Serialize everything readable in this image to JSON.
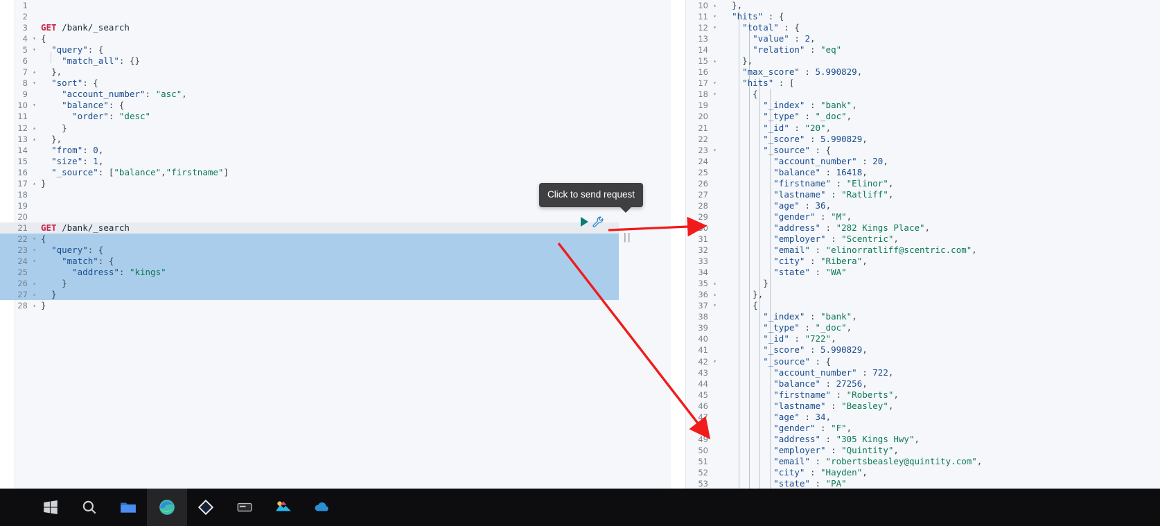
{
  "app": {
    "name": "kibana-dev-tools-console",
    "accent_teal": "#0b7a75",
    "highlight_blue": "#a9cdea",
    "tooltip_bg": "#3f3f42",
    "arrow_red": "#f01b1b"
  },
  "tooltip": {
    "text": "Click to send request"
  },
  "editor": {
    "icons": {
      "play": "play-icon",
      "wrench": "wrench-icon"
    },
    "lines": [
      {
        "n": "1",
        "fold": "",
        "text": ""
      },
      {
        "n": "2",
        "fold": "",
        "text": ""
      },
      {
        "n": "3",
        "fold": "",
        "text": "GET /bank/_search",
        "kind": "request"
      },
      {
        "n": "4",
        "fold": "▾",
        "text": "{"
      },
      {
        "n": "5",
        "fold": "▾",
        "text": "  \"query\": {"
      },
      {
        "n": "6",
        "fold": "",
        "text": "    \"match_all\": {}"
      },
      {
        "n": "7",
        "fold": "▴",
        "text": "  },"
      },
      {
        "n": "8",
        "fold": "▾",
        "text": "  \"sort\": {"
      },
      {
        "n": "9",
        "fold": "",
        "text": "    \"account_number\": \"asc\","
      },
      {
        "n": "10",
        "fold": "▾",
        "text": "    \"balance\": {"
      },
      {
        "n": "11",
        "fold": "",
        "text": "      \"order\": \"desc\""
      },
      {
        "n": "12",
        "fold": "▴",
        "text": "    }"
      },
      {
        "n": "13",
        "fold": "▴",
        "text": "  },"
      },
      {
        "n": "14",
        "fold": "",
        "text": "  \"from\": 0,"
      },
      {
        "n": "15",
        "fold": "",
        "text": "  \"size\": 1,"
      },
      {
        "n": "16",
        "fold": "",
        "text": "  \"_source\": [\"balance\",\"firstname\"]"
      },
      {
        "n": "17",
        "fold": "▴",
        "text": "}"
      },
      {
        "n": "18",
        "fold": "",
        "text": ""
      },
      {
        "n": "19",
        "fold": "",
        "text": ""
      },
      {
        "n": "20",
        "fold": "",
        "text": ""
      },
      {
        "n": "21",
        "fold": "",
        "text": "GET /bank/_search",
        "kind": "request",
        "selected": true,
        "current": true
      },
      {
        "n": "22",
        "fold": "▾",
        "text": "{",
        "selected": true
      },
      {
        "n": "23",
        "fold": "▾",
        "text": "  \"query\": {",
        "selected": true
      },
      {
        "n": "24",
        "fold": "▾",
        "text": "    \"match\": {",
        "selected": true
      },
      {
        "n": "25",
        "fold": "",
        "text": "      \"address\": \"kings\"",
        "selected": true
      },
      {
        "n": "26",
        "fold": "▴",
        "text": "    }",
        "selected": true
      },
      {
        "n": "27",
        "fold": "▴",
        "text": "  }",
        "selected": true
      },
      {
        "n": "28",
        "fold": "▴",
        "text": "}"
      }
    ]
  },
  "output": {
    "lines": [
      {
        "n": "10",
        "fold": "▴",
        "text": "  },"
      },
      {
        "n": "11",
        "fold": "▾",
        "text": "  \"hits\" : {"
      },
      {
        "n": "12",
        "fold": "▾",
        "text": "    \"total\" : {"
      },
      {
        "n": "13",
        "fold": "",
        "text": "      \"value\" : 2,"
      },
      {
        "n": "14",
        "fold": "",
        "text": "      \"relation\" : \"eq\""
      },
      {
        "n": "15",
        "fold": "▴",
        "text": "    },"
      },
      {
        "n": "16",
        "fold": "",
        "text": "    \"max_score\" : 5.990829,"
      },
      {
        "n": "17",
        "fold": "▾",
        "text": "    \"hits\" : ["
      },
      {
        "n": "18",
        "fold": "▾",
        "text": "      {"
      },
      {
        "n": "19",
        "fold": "",
        "text": "        \"_index\" : \"bank\","
      },
      {
        "n": "20",
        "fold": "",
        "text": "        \"_type\" : \"_doc\","
      },
      {
        "n": "21",
        "fold": "",
        "text": "        \"_id\" : \"20\","
      },
      {
        "n": "22",
        "fold": "",
        "text": "        \"_score\" : 5.990829,"
      },
      {
        "n": "23",
        "fold": "▾",
        "text": "        \"_source\" : {"
      },
      {
        "n": "24",
        "fold": "",
        "text": "          \"account_number\" : 20,"
      },
      {
        "n": "25",
        "fold": "",
        "text": "          \"balance\" : 16418,"
      },
      {
        "n": "26",
        "fold": "",
        "text": "          \"firstname\" : \"Elinor\","
      },
      {
        "n": "27",
        "fold": "",
        "text": "          \"lastname\" : \"Ratliff\","
      },
      {
        "n": "28",
        "fold": "",
        "text": "          \"age\" : 36,"
      },
      {
        "n": "29",
        "fold": "",
        "text": "          \"gender\" : \"M\","
      },
      {
        "n": "30",
        "fold": "",
        "text": "          \"address\" : \"282 Kings Place\","
      },
      {
        "n": "31",
        "fold": "",
        "text": "          \"employer\" : \"Scentric\","
      },
      {
        "n": "32",
        "fold": "",
        "text": "          \"email\" : \"elinorratliff@scentric.com\","
      },
      {
        "n": "33",
        "fold": "",
        "text": "          \"city\" : \"Ribera\","
      },
      {
        "n": "34",
        "fold": "",
        "text": "          \"state\" : \"WA\""
      },
      {
        "n": "35",
        "fold": "▴",
        "text": "        }"
      },
      {
        "n": "36",
        "fold": "▴",
        "text": "      },"
      },
      {
        "n": "37",
        "fold": "▾",
        "text": "      {"
      },
      {
        "n": "38",
        "fold": "",
        "text": "        \"_index\" : \"bank\","
      },
      {
        "n": "39",
        "fold": "",
        "text": "        \"_type\" : \"_doc\","
      },
      {
        "n": "40",
        "fold": "",
        "text": "        \"_id\" : \"722\","
      },
      {
        "n": "41",
        "fold": "",
        "text": "        \"_score\" : 5.990829,"
      },
      {
        "n": "42",
        "fold": "▾",
        "text": "        \"_source\" : {"
      },
      {
        "n": "43",
        "fold": "",
        "text": "          \"account_number\" : 722,"
      },
      {
        "n": "44",
        "fold": "",
        "text": "          \"balance\" : 27256,"
      },
      {
        "n": "45",
        "fold": "",
        "text": "          \"firstname\" : \"Roberts\","
      },
      {
        "n": "46",
        "fold": "",
        "text": "          \"lastname\" : \"Beasley\","
      },
      {
        "n": "47",
        "fold": "",
        "text": "          \"age\" : 34,"
      },
      {
        "n": "48",
        "fold": "",
        "text": "          \"gender\" : \"F\","
      },
      {
        "n": "49",
        "fold": "",
        "text": "          \"address\" : \"305 Kings Hwy\","
      },
      {
        "n": "50",
        "fold": "",
        "text": "          \"employer\" : \"Quintity\","
      },
      {
        "n": "51",
        "fold": "",
        "text": "          \"email\" : \"robertsbeasley@quintity.com\","
      },
      {
        "n": "52",
        "fold": "",
        "text": "          \"city\" : \"Hayden\","
      },
      {
        "n": "53",
        "fold": "",
        "text": "          \"state\" : \"PA\""
      }
    ]
  },
  "annotations": {
    "arrow_top": "red-arrow-to-address-282-kings-place",
    "arrow_bottom": "red-arrow-to-address-305-kings-hwy"
  },
  "taskbar": {
    "items": [
      {
        "name": "taskbar-windows-start",
        "glyph": "windows-icon"
      },
      {
        "name": "taskbar-search",
        "glyph": "search-icon"
      },
      {
        "name": "taskbar-file-explorer",
        "glyph": "folder-icon"
      },
      {
        "name": "taskbar-browser-edge",
        "glyph": "edge-icon",
        "active": true
      },
      {
        "name": "taskbar-vscode",
        "glyph": "vscode-icon"
      },
      {
        "name": "taskbar-terminal",
        "glyph": "terminal-icon"
      },
      {
        "name": "taskbar-photoshop",
        "glyph": "image-app-icon"
      },
      {
        "name": "taskbar-cloud",
        "glyph": "cloud-icon"
      }
    ]
  }
}
